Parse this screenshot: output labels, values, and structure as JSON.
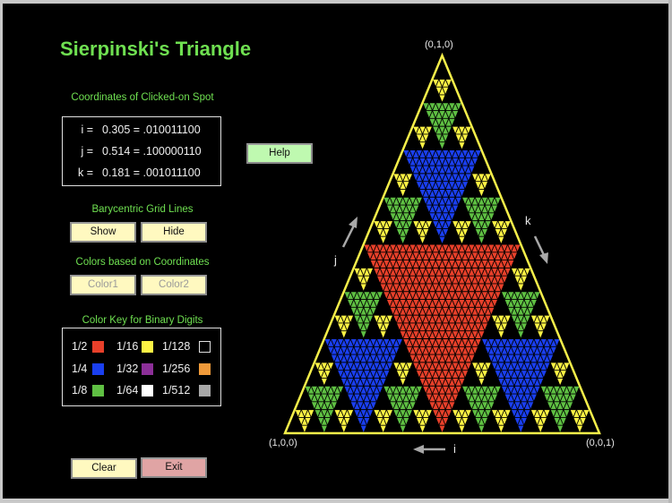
{
  "app": {
    "title": "Sierpinski's Triangle"
  },
  "coordinates": {
    "heading": "Coordinates of Clicked-on Spot",
    "rows": [
      {
        "label": "i =",
        "value": "0.305 = .010011100"
      },
      {
        "label": "j =",
        "value": "0.514 = .100000110"
      },
      {
        "label": "k =",
        "value": "0.181 = .001011100"
      }
    ]
  },
  "help_button": {
    "label": "Help"
  },
  "grid_lines": {
    "heading": "Barycentric Grid Lines",
    "show_label": "Show",
    "hide_label": "Hide"
  },
  "color_mode": {
    "heading": "Colors based on Coordinates",
    "color1_label": "Color1",
    "color2_label": "Color2"
  },
  "color_key": {
    "heading": "Color Key for Binary Digits",
    "items": [
      {
        "label": "1/2",
        "color": "#e8402a"
      },
      {
        "label": "1/4",
        "color": "#1a3ff0"
      },
      {
        "label": "1/8",
        "color": "#5fc043"
      },
      {
        "label": "1/16",
        "color": "#fdf344"
      },
      {
        "label": "1/32",
        "color": "#8c2f98"
      },
      {
        "label": "1/64",
        "color": "#ffffff"
      },
      {
        "label": "1/128",
        "color": "#000000"
      },
      {
        "label": "1/256",
        "color": "#f09a3a"
      },
      {
        "label": "1/512",
        "color": "#a8a8a8"
      }
    ]
  },
  "actions": {
    "clear_label": "Clear",
    "exit_label": "Exit"
  },
  "triangle": {
    "vertex_top": "(0,1,0)",
    "vertex_left": "(1,0,0)",
    "vertex_right": "(0,0,1)",
    "axis_i": "i",
    "axis_j": "j",
    "axis_k": "k",
    "outline_color": "#f4ee4a",
    "grid_divisions": 48,
    "level_colors": [
      "#e8402a",
      "#1a3ff0",
      "#5fc043",
      "#fdf344"
    ]
  }
}
